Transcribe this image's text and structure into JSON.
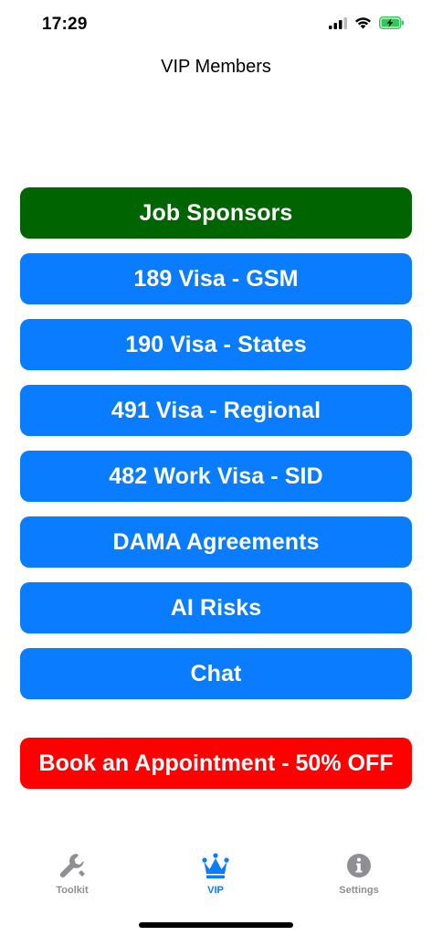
{
  "status_bar": {
    "time": "17:29"
  },
  "nav": {
    "title": "VIP Members"
  },
  "menu": {
    "items": [
      {
        "label": "Job Sponsors",
        "color": "#006400"
      },
      {
        "label": "189 Visa - GSM",
        "color": "#0a7cff"
      },
      {
        "label": "190 Visa - States",
        "color": "#0a7cff"
      },
      {
        "label": "491 Visa - Regional",
        "color": "#0a7cff"
      },
      {
        "label": "482 Work Visa - SID",
        "color": "#0a7cff"
      },
      {
        "label": "DAMA Agreements",
        "color": "#0a7cff"
      },
      {
        "label": "AI Risks",
        "color": "#0a7cff"
      },
      {
        "label": "Chat",
        "color": "#0a7cff"
      }
    ]
  },
  "promo": {
    "label": "Book an Appointment - 50% OFF",
    "color": "#ff0000"
  },
  "tabs": [
    {
      "label": "Toolkit",
      "icon": "wrench-icon",
      "active": false
    },
    {
      "label": "VIP",
      "icon": "crown-icon",
      "active": true
    },
    {
      "label": "Settings",
      "icon": "info-icon",
      "active": false
    }
  ],
  "colors": {
    "accent": "#0a7cff",
    "inactive": "#8e8e93",
    "battery": "#34c759"
  }
}
